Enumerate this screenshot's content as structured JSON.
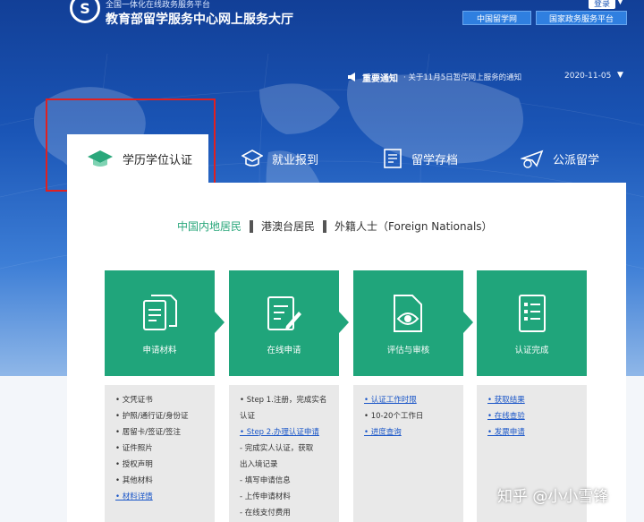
{
  "header": {
    "logo_letter": "S",
    "subtitle": "全国一体化在线政务服务平台",
    "title": "教育部留学服务中心网上服务大厅",
    "login_label": "登录",
    "links": [
      "中国留学网",
      "国家政务服务平台"
    ]
  },
  "notice": {
    "label": "重要通知",
    "text": "· 关于11月5日暂停网上服务的通知",
    "date": "2020-11-05"
  },
  "tabs": [
    {
      "label": "学历学位认证",
      "icon": "graduation-cap-icon",
      "active": true
    },
    {
      "label": "就业报到",
      "icon": "hat-icon",
      "active": false
    },
    {
      "label": "留学存档",
      "icon": "archive-icon",
      "active": false
    },
    {
      "label": "公派留学",
      "icon": "plane-icon",
      "active": false
    }
  ],
  "categories": [
    {
      "label": "中国内地居民",
      "active": true
    },
    {
      "label": "港澳台居民",
      "active": false
    },
    {
      "label": "外籍人士（Foreign Nationals）",
      "active": false
    }
  ],
  "steps": [
    {
      "label": "申请材料",
      "icon": "documents-icon"
    },
    {
      "label": "在线申请",
      "icon": "edit-form-icon"
    },
    {
      "label": "评估与审核",
      "icon": "review-eye-icon"
    },
    {
      "label": "认证完成",
      "icon": "checklist-icon"
    }
  ],
  "info": {
    "s1": [
      "• 文凭证书",
      "• 护照/通行证/身份证",
      "• 居留卡/签证/签注",
      "• 证件照片",
      "• 授权声明",
      "• 其他材料",
      "• 材料详情"
    ],
    "s2": [
      "• Step 1.注册，完成实名",
      "认证",
      "• Step 2.办理认证申请",
      "- 完成实人认证，获取",
      "出入境记录",
      "- 填写申请信息",
      "- 上传申请材料",
      "- 在线支付费用"
    ],
    "s3": [
      "• 认证工作时限",
      "• 10-20个工作日",
      "• 进度查询"
    ],
    "s4": [
      "• 获取结果",
      "• 在线查验",
      "• 发票申请"
    ]
  },
  "colors": {
    "brand_blue": "#1a55b6",
    "step_green": "#20a57b",
    "active_green": "#2aa77b",
    "highlight_red": "#e02020"
  },
  "watermark": "知乎 @小小雪锋"
}
